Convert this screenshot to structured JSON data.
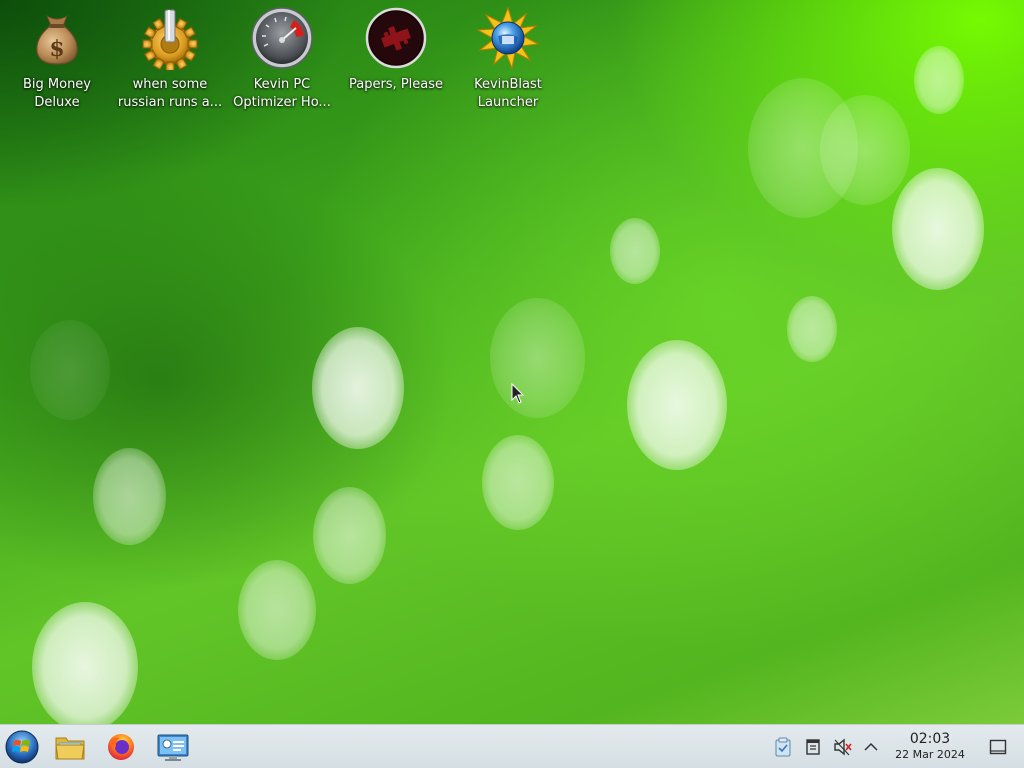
{
  "desktop": {
    "icons": [
      {
        "label": "Big Money\nDeluxe",
        "icon": "money-bag-icon"
      },
      {
        "label": "when some\nrussian runs a...",
        "icon": "gear-icon"
      },
      {
        "label": "Kevin PC\nOptimizer Ho...",
        "icon": "speedometer-icon"
      },
      {
        "label": "Papers, Please",
        "icon": "papers-please-icon"
      },
      {
        "label": "KevinBlast\nLauncher",
        "icon": "blast-globe-icon"
      }
    ]
  },
  "taskbar": {
    "launchers": [
      {
        "icon": "start-menu-icon"
      },
      {
        "icon": "file-manager-icon"
      },
      {
        "icon": "firefox-icon"
      },
      {
        "icon": "system-settings-icon"
      }
    ],
    "tray": [
      {
        "icon": "clipboard-icon"
      },
      {
        "icon": "notes-icon"
      },
      {
        "icon": "volume-muted-icon"
      },
      {
        "icon": "chevron-up-icon"
      }
    ],
    "clock": {
      "time": "02:03",
      "date": "22 Mar 2024"
    },
    "show_desktop_icon": "show-desktop-icon"
  },
  "colors": {
    "taskbar_bg": "#dfe7ea",
    "wallpaper_green": "#4caf1e",
    "label_text": "#ffffff"
  }
}
